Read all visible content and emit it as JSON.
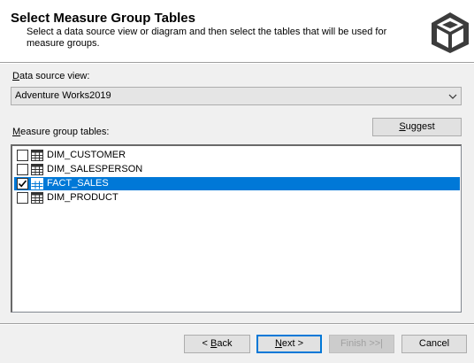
{
  "header": {
    "title": "Select Measure Group Tables",
    "description": "Select a data source view or diagram and then select the tables that will be used for measure groups."
  },
  "data_source_view": {
    "label_accel": "D",
    "label_rest": "ata source view:",
    "selected": "Adventure Works2019"
  },
  "measure_group_tables": {
    "label_accel": "M",
    "label_rest": "easure group tables:",
    "items": [
      {
        "label": "DIM_CUSTOMER",
        "checked": false,
        "selected": false
      },
      {
        "label": "DIM_SALESPERSON",
        "checked": false,
        "selected": false
      },
      {
        "label": "FACT_SALES",
        "checked": true,
        "selected": true
      },
      {
        "label": "DIM_PRODUCT",
        "checked": false,
        "selected": false
      }
    ]
  },
  "buttons": {
    "suggest_accel": "S",
    "suggest_rest": "uggest",
    "back_pre": "< ",
    "back_accel": "B",
    "back_rest": "ack",
    "next_accel": "N",
    "next_rest": "ext >",
    "finish": "Finish >>|",
    "cancel": "Cancel"
  },
  "colors": {
    "selection": "#0078d7",
    "dialog_bg": "#f0f0f0",
    "header_bg": "#ffffff"
  },
  "icons": [
    "cube-logo-icon",
    "chevron-down-icon",
    "checkbox-icon",
    "table-icon"
  ]
}
